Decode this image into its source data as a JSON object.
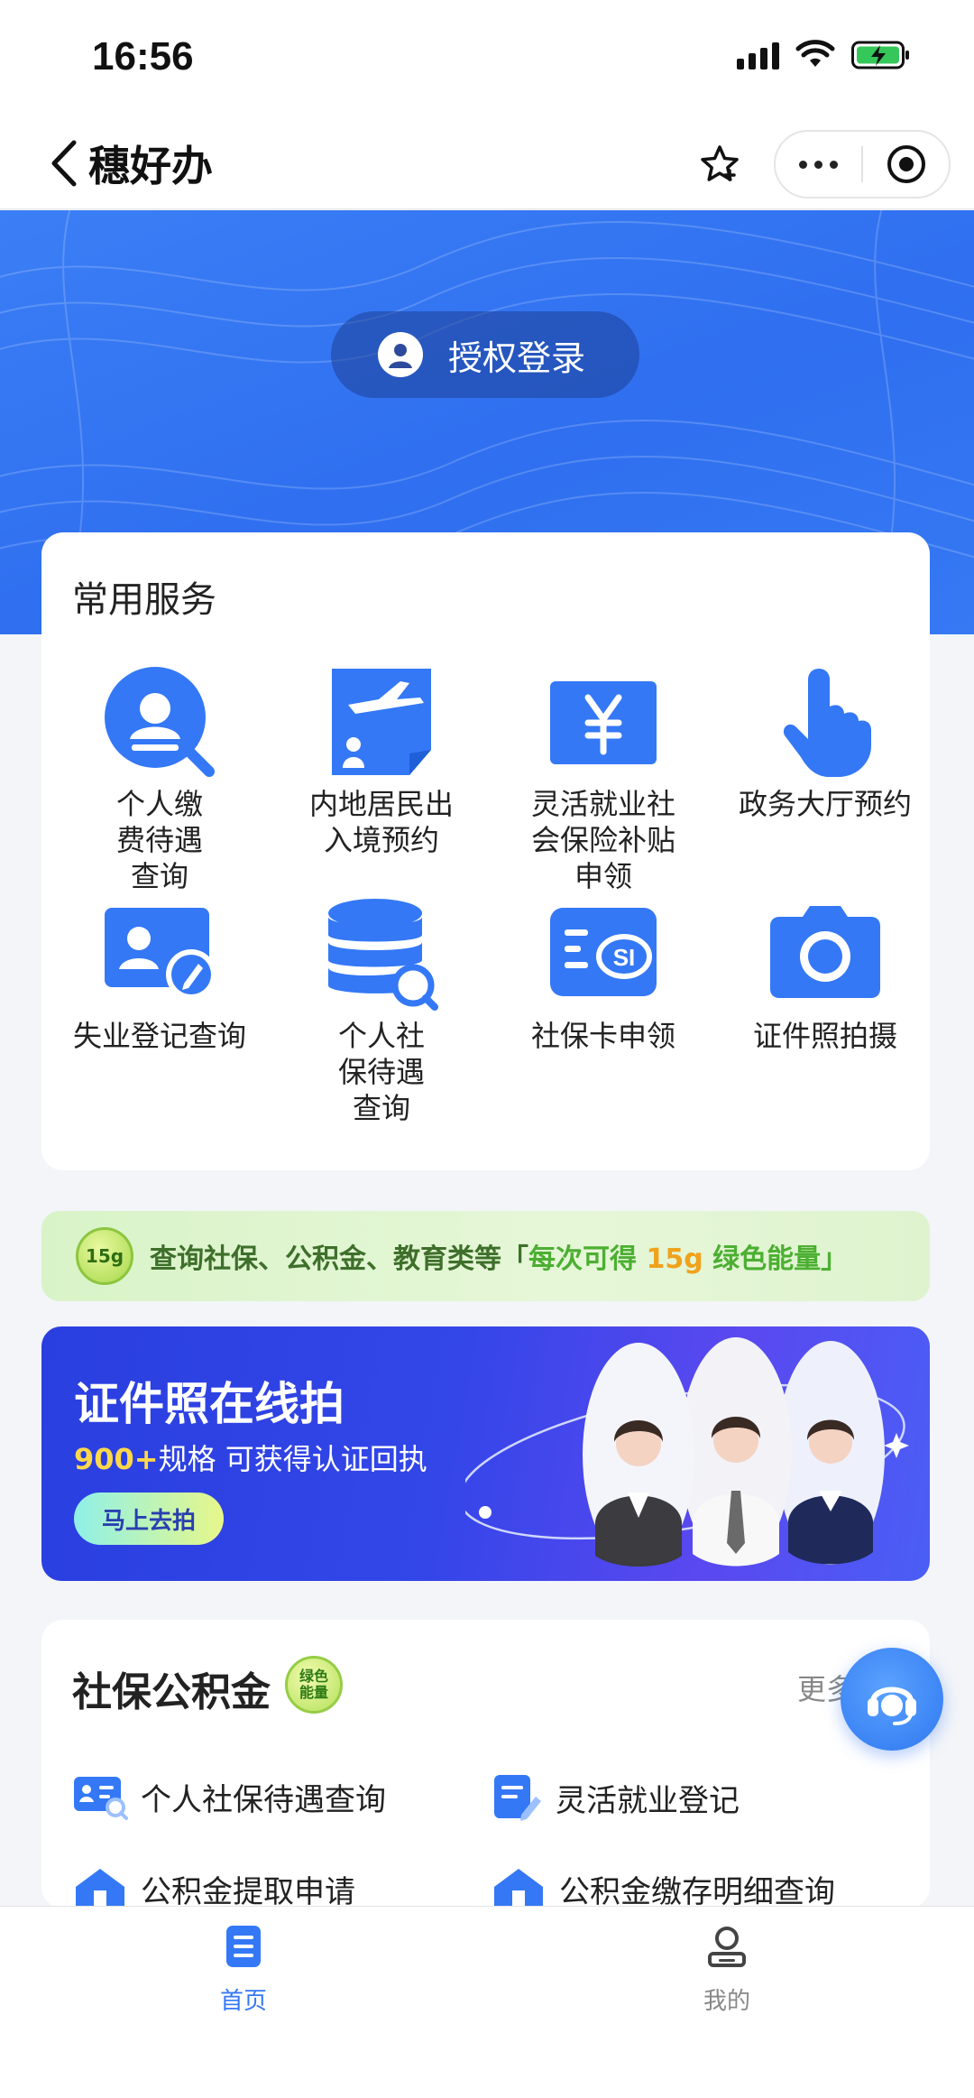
{
  "status_bar": {
    "time": "16:56"
  },
  "nav": {
    "title": "穗好办"
  },
  "hero": {
    "login_label": "授权登录"
  },
  "services": {
    "title": "常用服务",
    "items": [
      {
        "label": "个人缴\n费待遇\n查询",
        "icon": "person-search-icon"
      },
      {
        "label": "内地居民出\n入境预约",
        "icon": "airplane-document-icon"
      },
      {
        "label": "灵活就业社\n会保险补贴\n申领",
        "icon": "yuan-icon"
      },
      {
        "label": "政务大厅预约",
        "icon": "pointing-hand-icon"
      },
      {
        "label": "失业登记查询",
        "icon": "id-card-edit-icon"
      },
      {
        "label": "个人社\n保待遇\n查询",
        "icon": "database-search-icon"
      },
      {
        "label": "社保卡申领",
        "icon": "social-security-card-icon"
      },
      {
        "label": "证件照拍摄",
        "icon": "camera-icon"
      }
    ]
  },
  "energy_banner": {
    "badge": "15g",
    "text_prefix": "查询社保、公积金、教育类等「",
    "text_mid": "每次可得 ",
    "text_amount": "15g",
    "text_suffix": " 绿色能量」"
  },
  "photo_banner": {
    "title": "证件照在线拍",
    "sub_highlight": "900+",
    "sub_rest": "规格 可获得认证回执",
    "button": "马上去拍"
  },
  "shebao": {
    "title": "社保公积金",
    "badge": "绿色\n能量",
    "more": "更多",
    "items": [
      {
        "label": "个人社保待遇查询",
        "icon": "id-card-search-icon"
      },
      {
        "label": "灵活就业登记",
        "icon": "document-edit-icon"
      },
      {
        "label": "公积金提取申请",
        "icon": "house-icon"
      },
      {
        "label": "公积金缴存明细查询",
        "icon": "house-icon"
      }
    ]
  },
  "tabs": [
    {
      "label": "首页",
      "icon": "home-doc-icon",
      "active": true
    },
    {
      "label": "我的",
      "icon": "user-icon",
      "active": false
    }
  ],
  "colors": {
    "accent": "#3478f6",
    "tab_active": "#3478f6",
    "tab_inactive": "#888888"
  }
}
